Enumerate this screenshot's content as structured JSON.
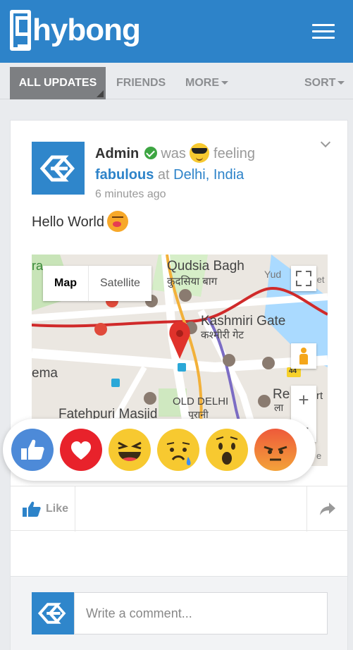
{
  "app": {
    "name": "hybong",
    "brand_color": "#2d83c9"
  },
  "header": {
    "menu_icon": "hamburger-menu-icon"
  },
  "tabs": {
    "all_updates": "ALL UPDATES",
    "friends": "FRIENDS",
    "more": "MORE",
    "sort": "SORT"
  },
  "post": {
    "author": "Admin",
    "verified": true,
    "was": "was",
    "feeling_label": "feeling",
    "feeling_value": "fabulous",
    "at": "at",
    "location": "Delhi, India",
    "time": "6 minutes ago",
    "text": "Hello World",
    "feeling_emoji": "sunglasses-emoji",
    "text_emoji": "kiss-emoji"
  },
  "map": {
    "type_map": "Map",
    "type_satellite": "Satellite",
    "labels": {
      "qudsia": "Qudsia Bagh",
      "qudsia_hi": "कुदसिया बाग",
      "kashmiri": "Kashmiri Gate",
      "kashmiri_hi": "कश्मीरी गेट",
      "old_delhi": "OLD DELHI",
      "old_delhi_hi": "पुरानी",
      "fatehpuri": "Fatehpuri Masjid",
      "cinema": "ema",
      "ra": "ra",
      "yud": "Yud",
      "set": "Set",
      "re": "Re",
      "la": "ला",
      "rt": "rt",
      "road_44": "44",
      "e": "e"
    },
    "zoom_in": "+",
    "zoom_out": "−"
  },
  "reactions": [
    "like",
    "love",
    "haha",
    "sad",
    "wow",
    "angry"
  ],
  "actions": {
    "like_label": "Like",
    "share_icon": "share-arrow-icon"
  },
  "comment": {
    "placeholder": "Write a comment..."
  }
}
